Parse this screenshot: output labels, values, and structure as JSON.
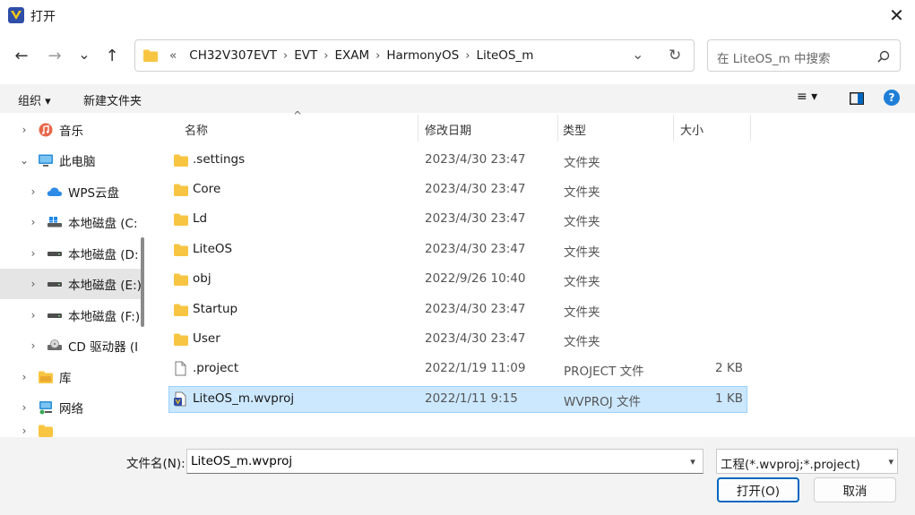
{
  "window": {
    "title": "打开",
    "close_glyph": "✕"
  },
  "nav": {
    "back": "←",
    "forward": "→",
    "recent": "⌄",
    "up": "↑"
  },
  "address": {
    "overflow": "«",
    "crumbs": [
      "CH32V307EVT",
      "EVT",
      "EXAM",
      "HarmonyOS",
      "LiteOS_m"
    ],
    "separator": "›",
    "dropdown": "⌄",
    "refresh": "↻"
  },
  "search": {
    "placeholder": "在 LiteOS_m 中搜索",
    "icon": "search-icon"
  },
  "toolbar": {
    "organize": "组织 ▾",
    "new_folder": "新建文件夹",
    "view": "≡ ▾",
    "help": "?"
  },
  "sidebar": {
    "items": [
      {
        "label": "音乐",
        "icon": "music-icon",
        "expanded": false
      },
      {
        "label": "此电脑",
        "icon": "computer-icon",
        "expanded": true
      },
      {
        "label": "WPS云盘",
        "icon": "cloud-icon",
        "expanded": false
      },
      {
        "label": "本地磁盘 (C:",
        "icon": "drive-c-icon",
        "expanded": false
      },
      {
        "label": "本地磁盘 (D:",
        "icon": "drive-icon",
        "expanded": false
      },
      {
        "label": "本地磁盘 (E:)",
        "icon": "drive-icon",
        "expanded": false
      },
      {
        "label": "本地磁盘 (F:)",
        "icon": "drive-icon",
        "expanded": false
      },
      {
        "label": "CD 驱动器 (I",
        "icon": "cd-drive-icon",
        "expanded": false
      },
      {
        "label": "库",
        "icon": "library-icon",
        "expanded": false
      },
      {
        "label": "网络",
        "icon": "network-icon",
        "expanded": false
      }
    ],
    "selected_index": 5
  },
  "columns": {
    "name": "名称",
    "date": "修改日期",
    "type": "类型",
    "size": "大小",
    "sort_glyph": "^"
  },
  "files": [
    {
      "name": ".settings",
      "date": "2023/4/30 23:47",
      "type": "文件夹",
      "size": "",
      "kind": "folder"
    },
    {
      "name": "Core",
      "date": "2023/4/30 23:47",
      "type": "文件夹",
      "size": "",
      "kind": "folder"
    },
    {
      "name": "Ld",
      "date": "2023/4/30 23:47",
      "type": "文件夹",
      "size": "",
      "kind": "folder"
    },
    {
      "name": "LiteOS",
      "date": "2023/4/30 23:47",
      "type": "文件夹",
      "size": "",
      "kind": "folder"
    },
    {
      "name": "obj",
      "date": "2022/9/26 10:40",
      "type": "文件夹",
      "size": "",
      "kind": "folder"
    },
    {
      "name": "Startup",
      "date": "2023/4/30 23:47",
      "type": "文件夹",
      "size": "",
      "kind": "folder"
    },
    {
      "name": "User",
      "date": "2023/4/30 23:47",
      "type": "文件夹",
      "size": "",
      "kind": "folder"
    },
    {
      "name": ".project",
      "date": "2022/1/19 11:09",
      "type": "PROJECT 文件",
      "size": "2 KB",
      "kind": "file"
    },
    {
      "name": "LiteOS_m.wvproj",
      "date": "2022/1/11 9:15",
      "type": "WVPROJ 文件",
      "size": "1 KB",
      "kind": "wvproj"
    }
  ],
  "selected_file_index": 8,
  "bottom": {
    "filename_label": "文件名(N):",
    "filename_value": "LiteOS_m.wvproj",
    "filter_value": "工程(*.wvproj;*.project)",
    "open_label": "打开(O)",
    "cancel_label": "取消"
  },
  "colors": {
    "accent": "#0067c0",
    "selection": "#cce8ff",
    "folder": "#f8c542"
  }
}
